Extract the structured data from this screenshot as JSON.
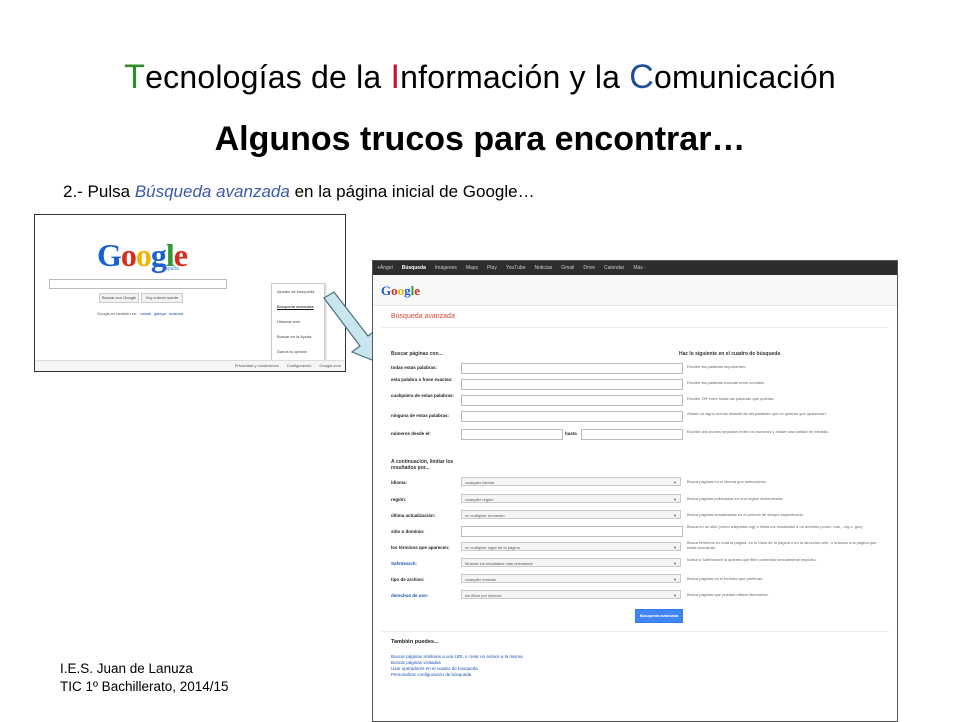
{
  "slide": {
    "title_parts": [
      "T",
      "ecnologías de la ",
      "I",
      "nformación y la ",
      "C",
      "omunicación"
    ],
    "subtitle": "Algunos trucos para encontrar…",
    "instruction": {
      "prefix": "2.- Pulsa ",
      "emphasis": "Búsqueda avanzada",
      "suffix": " en la página inicial de Google…"
    },
    "footer": {
      "line1": "I.E.S. Juan de Lanuza",
      "line2": "TIC 1º Bachillerato, 2014/15"
    },
    "colors": {
      "title_T": "#2e8b2e",
      "title_I": "#c8102e",
      "title_C": "#1f4e9c",
      "emphasis": "#3b5aa8"
    }
  },
  "google_home": {
    "logo_letters": [
      "G",
      "o",
      "o",
      "g",
      "l",
      "e"
    ],
    "tagline": "España",
    "buttons": [
      "Buscar con Google",
      "Voy a tener suerte"
    ],
    "offered_in": "Google.es también en:",
    "languages": [
      "català",
      "galego",
      "euskara"
    ],
    "settings_menu": [
      "Ajustes de búsqueda",
      "Búsqueda avanzada",
      "Historial web",
      "Buscar en la Ayuda",
      "Danos tu opinión"
    ],
    "footer_links": [
      "Privacidad y condiciones",
      "Configuración",
      "Google.com"
    ]
  },
  "advanced_search": {
    "topbar": [
      "+Ángel",
      "Búsqueda",
      "Imágenes",
      "Maps",
      "Play",
      "YouTube",
      "Noticias",
      "Gmail",
      "Drive",
      "Calendar",
      "Más -"
    ],
    "page_title": "Búsqueda avanzada",
    "find_pages_heading": "Buscar páginas con...",
    "do_this_heading": "Haz lo siguiente en el cuadro de búsqueda",
    "word_rows": [
      {
        "label": "todas estas palabras:",
        "hint": "Escribe las palabras importantes:"
      },
      {
        "label": "esta palabra o frase exactas:",
        "hint": "Escribe las palabras exactas entre comillas:"
      },
      {
        "label": "cualquiera de estas palabras:",
        "hint": "Escribe OR entre todas las palabras que quieras:"
      },
      {
        "label": "ninguna de estas palabras:",
        "hint": "Añade un signo menos delante de las palabras que no quieras que aparezcan:"
      },
      {
        "label": "números desde el:",
        "hint": "Escribe dos puntos seguidos entre los números y añade una unidad de medida:"
      }
    ],
    "range_to": "hasta",
    "narrow_heading": "A continuación, limitar los resultados por...",
    "filter_rows": [
      {
        "label": "idioma:",
        "value": "cualquier idioma",
        "hint": "Busca páginas en el idioma que selecciones.",
        "is_link": false
      },
      {
        "label": "región:",
        "value": "cualquier región",
        "hint": "Busca páginas publicadas en una región determinada.",
        "is_link": false
      },
      {
        "label": "última actualización:",
        "value": "en cualquier momento",
        "hint": "Busca páginas actualizadas en el periodo de tiempo especificado.",
        "is_link": false
      },
      {
        "label": "sitio o dominio:",
        "value": "",
        "hint": "Busca en un sitio (como wikipedia.org) o limita los resultados a un dominio (como .edu, .org o .gov)",
        "is_link": false
      },
      {
        "label": "los términos que aparecen:",
        "value": "en cualquier lugar de la página",
        "hint": "Busca términos en toda la página, en el título de la página o en la dirección web, o enlaces a la página que estás buscando.",
        "is_link": false
      },
      {
        "label": "SafeSearch:",
        "value": "Mostrar los resultados más relevantes",
        "hint": "Indica a SafeSearch si quieres que filtre contenido sexualmente explícito.",
        "is_link": true
      },
      {
        "label": "tipo de archivo:",
        "value": "cualquier formato",
        "hint": "Busca páginas en el formato que prefieras.",
        "is_link": false
      },
      {
        "label": "derechos de uso:",
        "value": "sin filtrar por licencia",
        "hint": "Busca páginas que puedas utilizar libremente.",
        "is_link": true
      }
    ],
    "submit": "Búsqueda avanzada",
    "also_heading": "También puedes...",
    "also_links": [
      "Buscar páginas similares a una URL o crear un enlace a la misma",
      "Buscar páginas visitadas",
      "Usar operadores en el cuadro de búsqueda",
      "Personalizar configuración de búsqueda"
    ]
  }
}
